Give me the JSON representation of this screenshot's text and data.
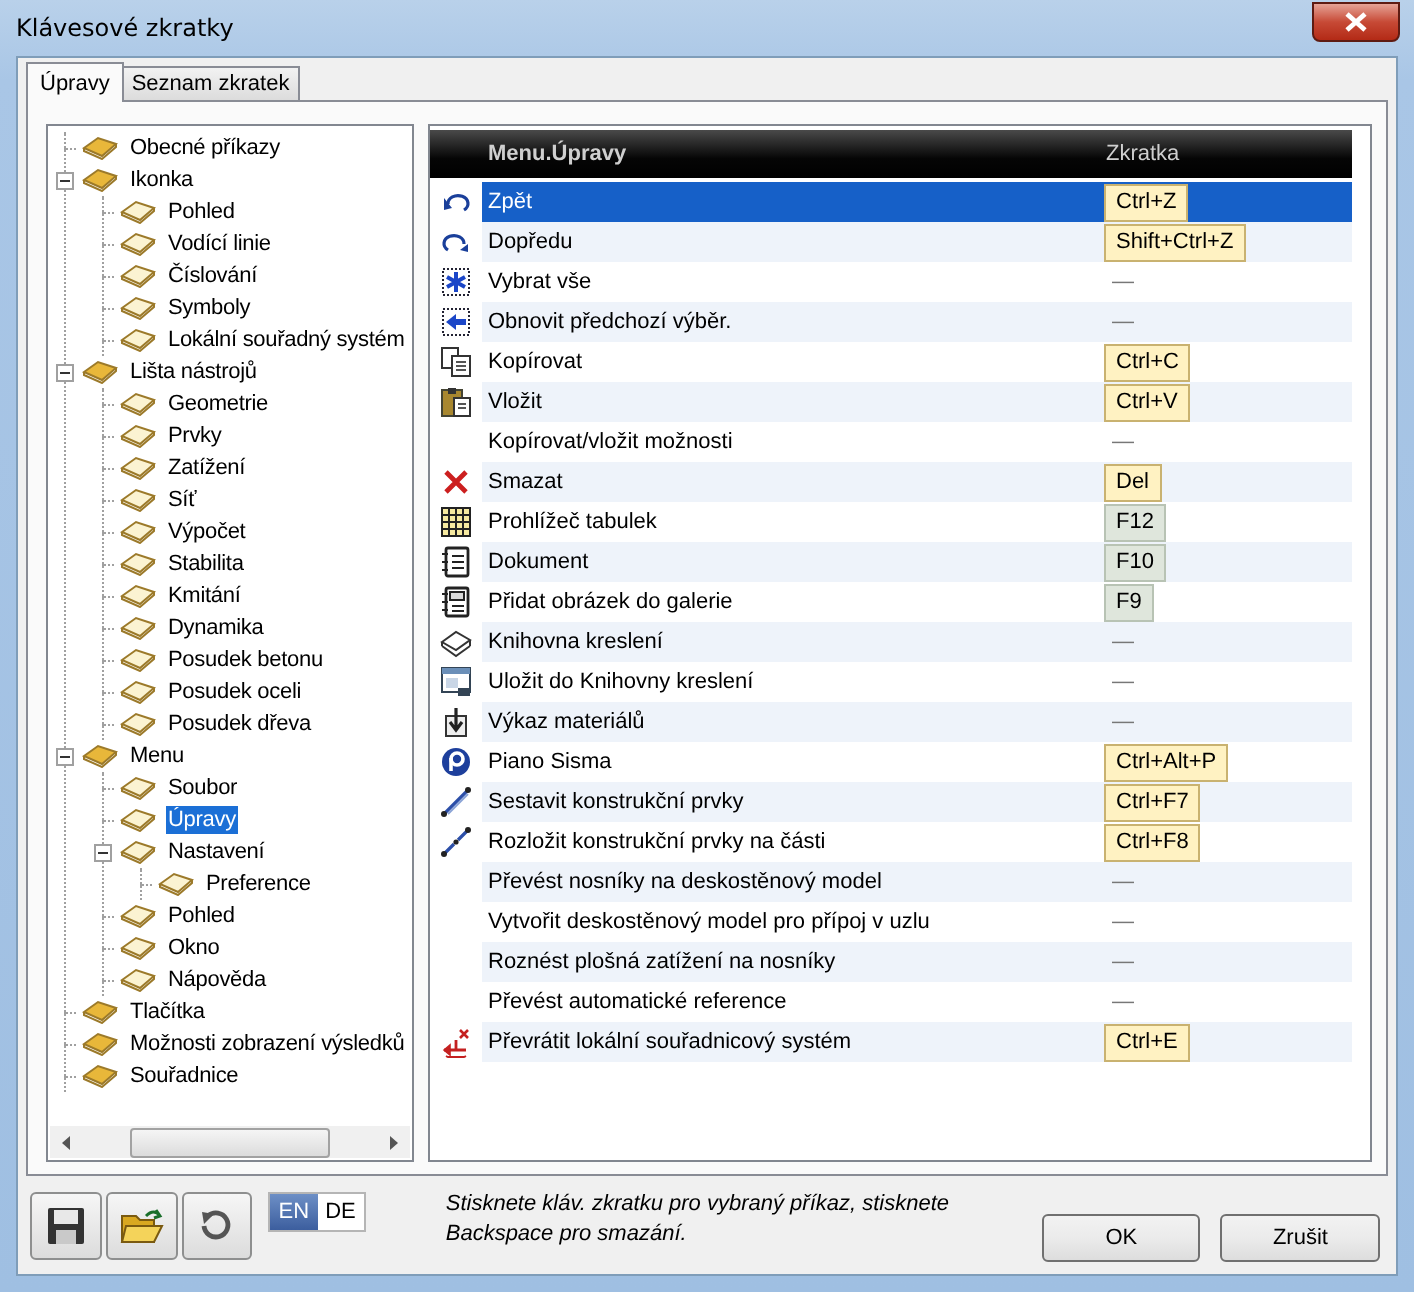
{
  "window": {
    "title": "Klávesové zkratky"
  },
  "tabs": [
    {
      "label": "Úpravy",
      "selected": true
    },
    {
      "label": "Seznam zkratek",
      "selected": false
    }
  ],
  "tree": [
    {
      "label": "Obecné příkazy",
      "selected": false
    },
    {
      "label": "Ikonka",
      "selected": false,
      "expanded": true,
      "children": [
        {
          "label": "Pohled",
          "selected": false
        },
        {
          "label": "Vodící linie",
          "selected": false
        },
        {
          "label": "Číslování",
          "selected": false
        },
        {
          "label": "Symboly",
          "selected": false
        },
        {
          "label": "Lokální souřadný systém",
          "selected": false
        }
      ]
    },
    {
      "label": "Lišta nástrojů",
      "selected": false,
      "expanded": true,
      "children": [
        {
          "label": "Geometrie",
          "selected": false
        },
        {
          "label": "Prvky",
          "selected": false
        },
        {
          "label": "Zatížení",
          "selected": false
        },
        {
          "label": "Síť",
          "selected": false
        },
        {
          "label": "Výpočet",
          "selected": false
        },
        {
          "label": "Stabilita",
          "selected": false
        },
        {
          "label": "Kmitání",
          "selected": false
        },
        {
          "label": "Dynamika",
          "selected": false
        },
        {
          "label": "Posudek betonu",
          "selected": false
        },
        {
          "label": "Posudek oceli",
          "selected": false
        },
        {
          "label": "Posudek dřeva",
          "selected": false
        }
      ]
    },
    {
      "label": "Menu",
      "selected": false,
      "expanded": true,
      "children": [
        {
          "label": "Soubor",
          "selected": false
        },
        {
          "label": "Úpravy",
          "selected": true
        },
        {
          "label": "Nastavení",
          "selected": false,
          "expanded": true,
          "children": [
            {
              "label": "Preference",
              "selected": false
            }
          ]
        },
        {
          "label": "Pohled",
          "selected": false
        },
        {
          "label": "Okno",
          "selected": false
        },
        {
          "label": "Nápověda",
          "selected": false
        }
      ]
    },
    {
      "label": "Tlačítka",
      "selected": false
    },
    {
      "label": "Možnosti zobrazení výsledků",
      "selected": false
    },
    {
      "label": "Souřadnice",
      "selected": false
    }
  ],
  "grid": {
    "columns": [
      "Menu.Úpravy",
      "Zkratka"
    ],
    "rows": [
      {
        "label": "Zpět",
        "shortcut": "Ctrl+Z",
        "kind": "combo",
        "selected": true
      },
      {
        "label": "Dopředu",
        "shortcut": "Shift+Ctrl+Z",
        "kind": "combo",
        "selected": false
      },
      {
        "label": "Vybrat vše",
        "shortcut": "—",
        "kind": "none",
        "selected": false
      },
      {
        "label": "Obnovit předchozí výběr.",
        "shortcut": "—",
        "kind": "none",
        "selected": false
      },
      {
        "label": "Kopírovat",
        "shortcut": "Ctrl+C",
        "kind": "combo",
        "selected": false
      },
      {
        "label": "Vložit",
        "shortcut": "Ctrl+V",
        "kind": "combo",
        "selected": false
      },
      {
        "label": "Kopírovat/vložit možnosti",
        "shortcut": "—",
        "kind": "none",
        "selected": false
      },
      {
        "label": "Smazat",
        "shortcut": "Del",
        "kind": "combo",
        "selected": false
      },
      {
        "label": "Prohlížeč tabulek",
        "shortcut": "F12",
        "kind": "function",
        "selected": false
      },
      {
        "label": "Dokument",
        "shortcut": "F10",
        "kind": "function",
        "selected": false
      },
      {
        "label": "Přidat obrázek do galerie",
        "shortcut": "F9",
        "kind": "function",
        "selected": false
      },
      {
        "label": "Knihovna kreslení",
        "shortcut": "—",
        "kind": "none",
        "selected": false
      },
      {
        "label": "Uložit do Knihovny kreslení",
        "shortcut": "—",
        "kind": "none",
        "selected": false
      },
      {
        "label": "Výkaz materiálů",
        "shortcut": "—",
        "kind": "none",
        "selected": false
      },
      {
        "label": "Piano Sisma",
        "shortcut": "Ctrl+Alt+P",
        "kind": "combo",
        "selected": false
      },
      {
        "label": "Sestavit konstrukční prvky",
        "shortcut": "Ctrl+F7",
        "kind": "combo",
        "selected": false
      },
      {
        "label": "Rozložit konstrukční prvky na části",
        "shortcut": "Ctrl+F8",
        "kind": "combo",
        "selected": false
      },
      {
        "label": "Převést nosníky na deskostěnový model",
        "shortcut": "—",
        "kind": "none",
        "selected": false
      },
      {
        "label": "Vytvořit deskostěnový model pro přípoj v uzlu",
        "shortcut": "—",
        "kind": "none",
        "selected": false
      },
      {
        "label": "Roznést plošná zatížení na nosníky",
        "shortcut": "—",
        "kind": "none",
        "selected": false
      },
      {
        "label": "Převést automatické reference",
        "shortcut": "—",
        "kind": "none",
        "selected": false
      },
      {
        "label": "Převrátit lokální souřadnicový systém",
        "shortcut": "Ctrl+E",
        "kind": "combo",
        "selected": false
      }
    ]
  },
  "languages": [
    {
      "label": "EN",
      "selected": true
    },
    {
      "label": "DE",
      "selected": false
    }
  ],
  "hint": "Stisknete kláv. zkratku pro vybraný příkaz, stisknete Backspace pro smazání.",
  "buttons": [
    "OK",
    "Zrušit"
  ]
}
